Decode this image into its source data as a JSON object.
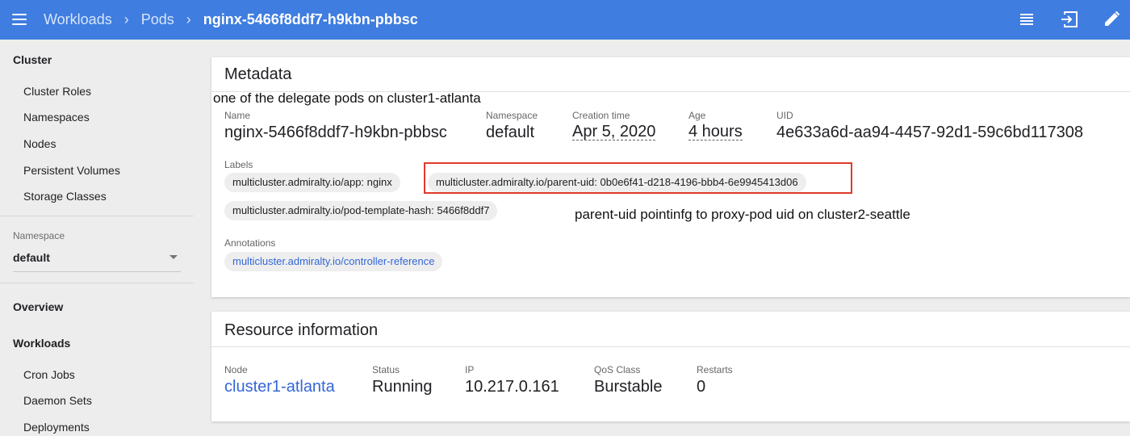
{
  "header": {
    "breadcrumbs": [
      "Workloads",
      "Pods"
    ],
    "current": "nginx-5466f8ddf7-h9kbn-pbbsc",
    "icons": [
      "menu-icon",
      "logs-icon",
      "exec-icon",
      "edit-icon"
    ]
  },
  "sidebar": {
    "cluster_title": "Cluster",
    "cluster_items": [
      "Cluster Roles",
      "Namespaces",
      "Nodes",
      "Persistent Volumes",
      "Storage Classes"
    ],
    "namespace_label": "Namespace",
    "namespace_value": "default",
    "overview_label": "Overview",
    "workloads_title": "Workloads",
    "workloads_items": [
      "Cron Jobs",
      "Daemon Sets",
      "Deployments"
    ]
  },
  "metadata": {
    "title": "Metadata",
    "annotation_note": "one of the delegate pods on cluster1-atlanta",
    "fields": {
      "name": {
        "label": "Name",
        "value": "nginx-5466f8ddf7-h9kbn-pbbsc"
      },
      "namespace": {
        "label": "Namespace",
        "value": "default"
      },
      "creation": {
        "label": "Creation time",
        "value": "Apr 5, 2020"
      },
      "age": {
        "label": "Age",
        "value": "4 hours"
      },
      "uid": {
        "label": "UID",
        "value": "4e633a6d-aa94-4457-92d1-59c6bd117308"
      }
    },
    "labels_label": "Labels",
    "labels": [
      "multicluster.admiralty.io/app: nginx",
      "multicluster.admiralty.io/parent-uid: 0b0e6f41-d218-4196-bbb4-6e9945413d06",
      "multicluster.admiralty.io/pod-template-hash: 5466f8ddf7"
    ],
    "parent_uid_note": "parent-uid pointinfg to proxy-pod uid on cluster2-seattle",
    "annotations_label": "Annotations",
    "annotations": [
      "multicluster.admiralty.io/controller-reference"
    ],
    "highlight_color": "#e03a2a"
  },
  "resource": {
    "title": "Resource information",
    "fields": {
      "node": {
        "label": "Node",
        "value": "cluster1-atlanta"
      },
      "status": {
        "label": "Status",
        "value": "Running"
      },
      "ip": {
        "label": "IP",
        "value": "10.217.0.161"
      },
      "qos": {
        "label": "QoS Class",
        "value": "Burstable"
      },
      "restarts": {
        "label": "Restarts",
        "value": "0"
      }
    }
  },
  "colors": {
    "topbar": "#3f7de0",
    "link": "#3367d6",
    "background": "#ededed"
  }
}
